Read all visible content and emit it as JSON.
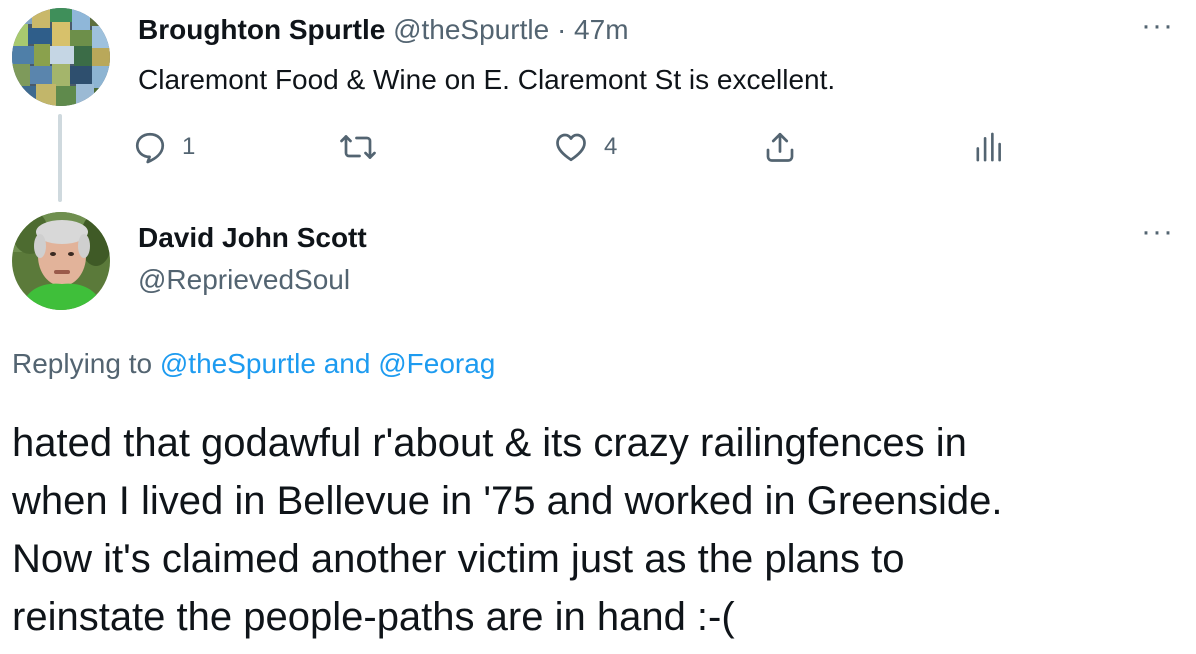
{
  "tweet1": {
    "author_name": "Broughton Spurtle",
    "handle": "@theSpurtle",
    "separator": "·",
    "time": "47m",
    "text": "Claremont Food & Wine on E. Claremont St is excellent.",
    "more_label": "···",
    "actions": {
      "reply_count": "1",
      "retweet_count": "",
      "like_count": "4"
    }
  },
  "tweet2": {
    "author_name": "David John Scott",
    "handle": "@ReprievedSoul",
    "more_label": "···",
    "replying_prefix": "Replying to",
    "replying_mention_1": "@theSpurtle",
    "replying_joiner": "and",
    "replying_mention_2": "@Feorag",
    "body_lines": [
      "hated that godawful r'about & its crazy railingfences in",
      "when I lived in Bellevue in '75 and worked in Greenside.",
      "Now it's claimed another victim just as  the plans to",
      "reinstate the people-paths are in hand :-("
    ]
  },
  "colors": {
    "text": "#0f1419",
    "secondary": "#536471",
    "link": "#1d9bf0",
    "thread_line": "#cfd9de"
  },
  "icons": {
    "reply": "reply-icon",
    "retweet": "retweet-icon",
    "like": "heart-icon",
    "share": "share-icon",
    "analytics": "analytics-icon",
    "more": "more-icon"
  }
}
